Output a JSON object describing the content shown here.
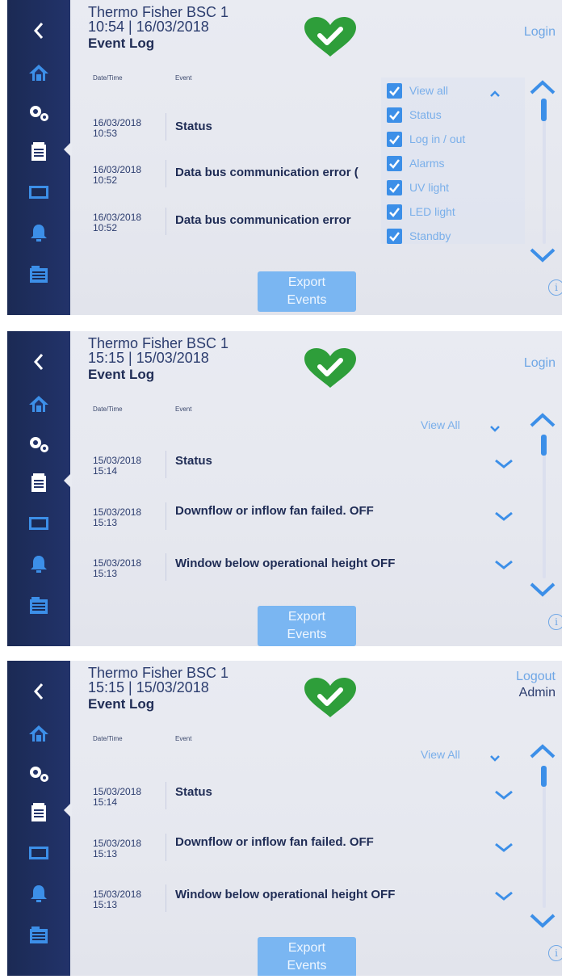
{
  "colors": {
    "sidebar": "#1b2a54",
    "accent": "#3c8fe8",
    "heart": "#2e9e3a",
    "button": "#7ab6f2",
    "link": "#6fa7e6"
  },
  "panels": [
    {
      "title": "Thermo Fisher BSC 1",
      "datetime": "10:54 | 16/03/2018",
      "page_title": "Event Log",
      "login_label": "Login",
      "login_user": "",
      "col_date": "Date/Time",
      "col_event": "Event",
      "rows": [
        {
          "date": "16/03/2018",
          "time": "10:53",
          "event": "Status"
        },
        {
          "date": "16/03/2018",
          "time": "10:52",
          "event": "Data bus communication error ("
        },
        {
          "date": "16/03/2018",
          "time": "10:52",
          "event": "Data bus communication error"
        }
      ],
      "filter_open": true,
      "filters": [
        "View all",
        "Status",
        "Log in / out",
        "Alarms",
        "UV light",
        "LED light",
        "Standby"
      ],
      "export_line1": "Export",
      "export_line2": "Events",
      "info_icon": "i"
    },
    {
      "title": "Thermo Fisher BSC 1",
      "datetime": "15:15 | 15/03/2018",
      "page_title": "Event Log",
      "login_label": "Login",
      "login_user": "",
      "col_date": "Date/Time",
      "col_event": "Event",
      "view_filter": "View All",
      "rows": [
        {
          "date": "15/03/2018",
          "time": "15:14",
          "event": "Status"
        },
        {
          "date": "15/03/2018",
          "time": "15:13",
          "event": "Downflow or inflow fan failed. OFF"
        },
        {
          "date": "15/03/2018",
          "time": "15:13",
          "event": "Window below operational height OFF"
        }
      ],
      "filter_open": false,
      "export_line1": "Export",
      "export_line2": "Events",
      "info_icon": "i"
    },
    {
      "title": "Thermo Fisher BSC 1",
      "datetime": "15:15 | 15/03/2018",
      "page_title": "Event Log",
      "login_label": "Logout",
      "login_user": "Admin",
      "col_date": "Date/Time",
      "col_event": "Event",
      "view_filter": "View All",
      "rows": [
        {
          "date": "15/03/2018",
          "time": "15:14",
          "event": "Status"
        },
        {
          "date": "15/03/2018",
          "time": "15:13",
          "event": "Downflow or inflow fan failed. OFF"
        },
        {
          "date": "15/03/2018",
          "time": "15:13",
          "event": "Window below operational height OFF"
        }
      ],
      "filter_open": false,
      "export_line1": "Export",
      "export_line2": "Events",
      "info_icon": "i"
    }
  ],
  "sidebar_icons": [
    "back-icon",
    "home-icon",
    "settings-icon",
    "event-log-icon",
    "display-icon",
    "alarm-bell-icon",
    "records-icon"
  ]
}
